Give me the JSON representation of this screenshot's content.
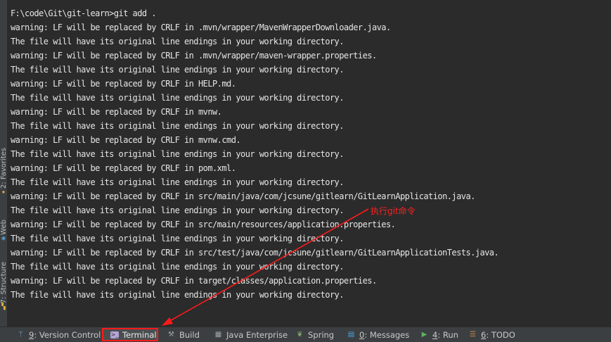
{
  "terminal": {
    "lines": [
      "F:\\code\\Git\\git-learn>git add .",
      "warning: LF will be replaced by CRLF in .mvn/wrapper/MavenWrapperDownloader.java.",
      "The file will have its original line endings in your working directory.",
      "warning: LF will be replaced by CRLF in .mvn/wrapper/maven-wrapper.properties.",
      "The file will have its original line endings in your working directory.",
      "warning: LF will be replaced by CRLF in HELP.md.",
      "The file will have its original line endings in your working directory.",
      "warning: LF will be replaced by CRLF in mvnw.",
      "The file will have its original line endings in your working directory.",
      "warning: LF will be replaced by CRLF in mvnw.cmd.",
      "The file will have its original line endings in your working directory.",
      "warning: LF will be replaced by CRLF in pom.xml.",
      "The file will have its original line endings in your working directory.",
      "warning: LF will be replaced by CRLF in src/main/java/com/jcsune/gitlearn/GitLearnApplication.java.",
      "The file will have its original line endings in your working directory.",
      "warning: LF will be replaced by CRLF in src/main/resources/application.properties.",
      "The file will have its original line endings in your working directory.",
      "warning: LF will be replaced by CRLF in src/test/java/com/jcsune/gitlearn/GitLearnApplicationTests.java.",
      "The file will have its original line endings in your working directory.",
      "warning: LF will be replaced by CRLF in target/classes/application.properties.",
      "The file will have its original line endings in your working directory."
    ]
  },
  "annotation": {
    "text": "执行git命令",
    "color": "#ff1a1a"
  },
  "side_tabs": {
    "favorites": {
      "label": "2: Favorites",
      "icon": "star-icon"
    },
    "web": {
      "label": "Web",
      "icon": "globe-icon"
    },
    "structure": {
      "label": "7: Structure",
      "icon": "structure-icon"
    }
  },
  "bottom_bar": {
    "version_control": {
      "key": "9",
      "label": ": Version Control",
      "icon": "branch-icon"
    },
    "terminal": {
      "label": "Terminal",
      "icon": "terminal-icon"
    },
    "build": {
      "label": "Build",
      "icon": "hammer-icon"
    },
    "java_enterprise": {
      "label": "Java Enterprise",
      "icon": "java-enterprise-icon"
    },
    "spring": {
      "label": "Spring",
      "icon": "spring-leaf-icon"
    },
    "messages": {
      "key": "0",
      "label": ": Messages",
      "icon": "message-icon"
    },
    "run": {
      "key": "4",
      "label": ": Run",
      "icon": "run-icon"
    },
    "todo": {
      "key": "6",
      "label": ": TODO",
      "icon": "todo-icon"
    }
  }
}
